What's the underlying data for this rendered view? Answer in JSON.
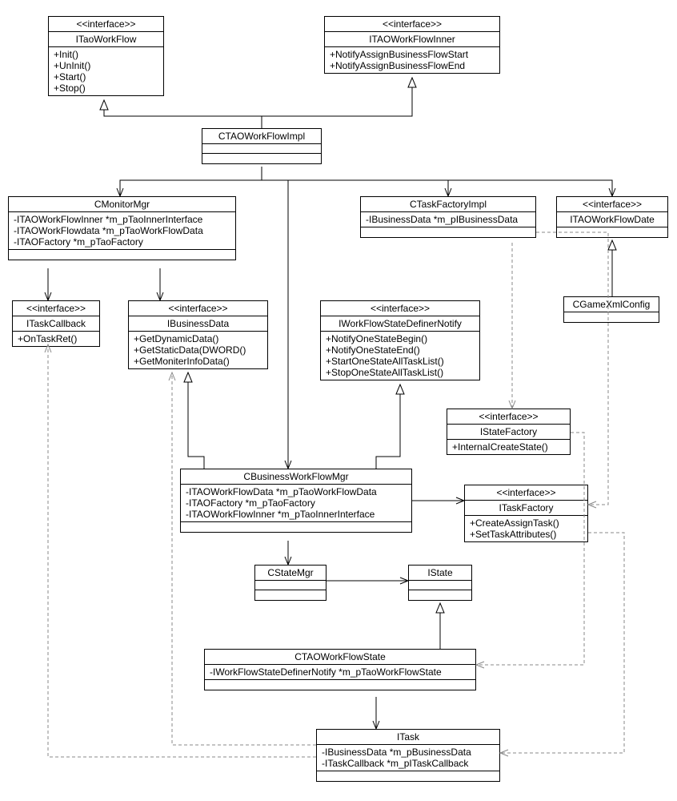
{
  "stereotype": {
    "interface": "<<interface>>"
  },
  "classes": {
    "ITaoWorkFlow": {
      "name": "ITaoWorkFlow",
      "ops": [
        "+Init()",
        "+UnInit()",
        "+Start()",
        "+Stop()"
      ]
    },
    "ITAOWorkFlowInner": {
      "name": "ITAOWorkFlowInner",
      "ops": [
        "+NotifyAssignBusinessFlowStart",
        "+NotifyAssignBusinessFlowEnd"
      ]
    },
    "CTAOWorkFlowImpl": {
      "name": "CTAOWorkFlowImpl"
    },
    "CMonitorMgr": {
      "name": "CMonitorMgr",
      "attrs": [
        "-ITAOWorkFlowInner *m_pTaoInnerInterface",
        "-ITAOWorkFlowdata *m_pTaoWorkFlowData",
        "-ITAOFactory *m_pTaoFactory"
      ]
    },
    "CTaskFactoryImpl": {
      "name": "CTaskFactoryImpl",
      "attrs": [
        "-IBusinessData *m_pIBusinessData"
      ]
    },
    "ITAOWorkFlowDate": {
      "name": "ITAOWorkFlowDate"
    },
    "CGameXmlConfig": {
      "name": "CGameXmlConfig"
    },
    "ITaskCallback": {
      "name": "ITaskCallback",
      "ops": [
        "+OnTaskRet()"
      ]
    },
    "IBusinessData": {
      "name": "IBusinessData",
      "ops": [
        "+GetDynamicData()",
        "+GetStaticData(DWORD()",
        "+GetMoniterInfoData()"
      ]
    },
    "IWorkFlowStateDefinerNotify": {
      "name": "IWorkFlowStateDefinerNotify",
      "ops": [
        "+NotifyOneStateBegin()",
        "+NotifyOneStateEnd()",
        "+StartOneStateAllTaskList()",
        "+StopOneStateAllTaskList()"
      ]
    },
    "IStateFactory": {
      "name": "IStateFactory",
      "ops": [
        "+InternaICreateState()"
      ]
    },
    "CBusinessWorkFlowMgr": {
      "name": "CBusinessWorkFlowMgr",
      "attrs": [
        "-ITAOWorkFlowData *m_pTaoWorkFlowData",
        "-ITAOFactory *m_pTaoFactory",
        "-ITAOWorkFlowInner *m_pTaoInnerInterface"
      ]
    },
    "ITaskFactory": {
      "name": "ITaskFactory",
      "ops": [
        "+CreateAssignTask()",
        "+SetTaskAttributes()"
      ]
    },
    "CStateMgr": {
      "name": "CStateMgr"
    },
    "IState": {
      "name": "IState"
    },
    "CTAOWorkFlowState": {
      "name": "CTAOWorkFlowState",
      "attrs": [
        "-IWorkFlowStateDefinerNotify *m_pTaoWorkFlowState"
      ]
    },
    "ITask": {
      "name": "ITask",
      "attrs": [
        "-IBusinessData *m_pBusinessData",
        "-ITaskCallback *m_pITaskCallback"
      ]
    }
  },
  "chart_data": {
    "type": "uml-class-diagram",
    "classes": [
      {
        "id": "ITaoWorkFlow",
        "stereotype": "interface",
        "operations": [
          "+Init()",
          "+UnInit()",
          "+Start()",
          "+Stop()"
        ]
      },
      {
        "id": "ITAOWorkFlowInner",
        "stereotype": "interface",
        "operations": [
          "+NotifyAssignBusinessFlowStart",
          "+NotifyAssignBusinessFlowEnd"
        ]
      },
      {
        "id": "CTAOWorkFlowImpl"
      },
      {
        "id": "CMonitorMgr",
        "attributes": [
          "-ITAOWorkFlowInner *m_pTaoInnerInterface",
          "-ITAOWorkFlowdata *m_pTaoWorkFlowData",
          "-ITAOFactory *m_pTaoFactory"
        ]
      },
      {
        "id": "CTaskFactoryImpl",
        "attributes": [
          "-IBusinessData *m_pIBusinessData"
        ]
      },
      {
        "id": "ITAOWorkFlowDate",
        "stereotype": "interface"
      },
      {
        "id": "CGameXmlConfig"
      },
      {
        "id": "ITaskCallback",
        "stereotype": "interface",
        "operations": [
          "+OnTaskRet()"
        ]
      },
      {
        "id": "IBusinessData",
        "stereotype": "interface",
        "operations": [
          "+GetDynamicData()",
          "+GetStaticData(DWORD()",
          "+GetMoniterInfoData()"
        ]
      },
      {
        "id": "IWorkFlowStateDefinerNotify",
        "stereotype": "interface",
        "operations": [
          "+NotifyOneStateBegin()",
          "+NotifyOneStateEnd()",
          "+StartOneStateAllTaskList()",
          "+StopOneStateAllTaskList()"
        ]
      },
      {
        "id": "IStateFactory",
        "stereotype": "interface",
        "operations": [
          "+InternaICreateState()"
        ]
      },
      {
        "id": "CBusinessWorkFlowMgr",
        "attributes": [
          "-ITAOWorkFlowData *m_pTaoWorkFlowData",
          "-ITAOFactory *m_pTaoFactory",
          "-ITAOWorkFlowInner *m_pTaoInnerInterface"
        ]
      },
      {
        "id": "ITaskFactory",
        "stereotype": "interface",
        "operations": [
          "+CreateAssignTask()",
          "+SetTaskAttributes()"
        ]
      },
      {
        "id": "CStateMgr"
      },
      {
        "id": "IState"
      },
      {
        "id": "CTAOWorkFlowState",
        "attributes": [
          "-IWorkFlowStateDefinerNotify *m_pTaoWorkFlowState"
        ]
      },
      {
        "id": "ITask",
        "attributes": [
          "-IBusinessData *m_pBusinessData",
          "-ITaskCallback *m_pITaskCallback"
        ]
      }
    ],
    "relations": [
      {
        "from": "CTAOWorkFlowImpl",
        "to": "ITaoWorkFlow",
        "type": "realization"
      },
      {
        "from": "CTAOWorkFlowImpl",
        "to": "ITAOWorkFlowInner",
        "type": "realization"
      },
      {
        "from": "CTAOWorkFlowImpl",
        "to": "CMonitorMgr",
        "type": "association"
      },
      {
        "from": "CTAOWorkFlowImpl",
        "to": "CTaskFactoryImpl",
        "type": "association"
      },
      {
        "from": "CTAOWorkFlowImpl",
        "to": "ITAOWorkFlowDate",
        "type": "association"
      },
      {
        "from": "CGameXmlConfig",
        "to": "ITAOWorkFlowDate",
        "type": "realization"
      },
      {
        "from": "CMonitorMgr",
        "to": "ITaskCallback",
        "type": "association"
      },
      {
        "from": "CMonitorMgr",
        "to": "IBusinessData",
        "type": "association"
      },
      {
        "from": "CBusinessWorkFlowMgr",
        "to": "IBusinessData",
        "type": "realization"
      },
      {
        "from": "CBusinessWorkFlowMgr",
        "to": "IWorkFlowStateDefinerNotify",
        "type": "realization"
      },
      {
        "from": "CTAOWorkFlowImpl",
        "to": "CBusinessWorkFlowMgr",
        "type": "association"
      },
      {
        "from": "CBusinessWorkFlowMgr",
        "to": "ITaskFactory",
        "type": "association"
      },
      {
        "from": "CBusinessWorkFlowMgr",
        "to": "CStateMgr",
        "type": "association"
      },
      {
        "from": "CStateMgr",
        "to": "IState",
        "type": "association"
      },
      {
        "from": "CTAOWorkFlowState",
        "to": "IState",
        "type": "realization"
      },
      {
        "from": "CTAOWorkFlowState",
        "to": "ITask",
        "type": "association"
      },
      {
        "from": "CTaskFactoryImpl",
        "to": "IStateFactory",
        "type": "dependency"
      },
      {
        "from": "CTaskFactoryImpl",
        "to": "ITaskFactory",
        "type": "dependency"
      },
      {
        "from": "IStateFactory",
        "to": "CTAOWorkFlowState",
        "type": "dependency"
      },
      {
        "from": "ITaskFactory",
        "to": "ITask",
        "type": "dependency"
      },
      {
        "from": "ITask",
        "to": "ITaskCallback",
        "type": "dependency"
      },
      {
        "from": "ITask",
        "to": "IBusinessData",
        "type": "dependency"
      }
    ]
  }
}
